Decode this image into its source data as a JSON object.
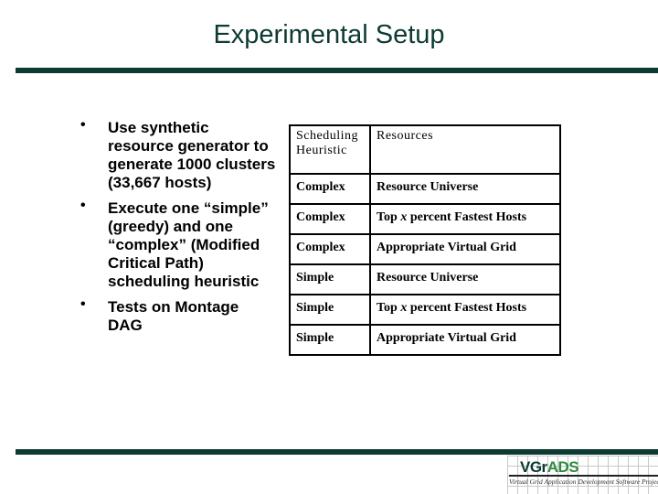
{
  "slide": {
    "title": "Experimental Setup",
    "bullets": [
      "Use synthetic resource generator to generate 1000 clusters (33,667 hosts)",
      "Execute one “simple” (greedy) and one “complex” (Modified Critical Path) scheduling heuristic",
      "Tests on Montage DAG"
    ],
    "bullet_glyph": "•",
    "table": {
      "headers": [
        "Scheduling Heuristic",
        "Resources"
      ],
      "rows": [
        [
          "Complex",
          "Resource Universe"
        ],
        [
          "Complex",
          "Top x percent Fastest Hosts"
        ],
        [
          "Complex",
          "Appropriate Virtual Grid"
        ],
        [
          "Simple",
          "Resource Universe"
        ],
        [
          "Simple",
          "Top x percent Fastest Hosts"
        ],
        [
          "Simple",
          "Appropriate Virtual Grid"
        ]
      ]
    },
    "logo": {
      "name_main": "VGr",
      "name_accent": "ADS",
      "subtitle": "Virtual Grid Application Development Software Project"
    },
    "colors": {
      "accent": "#0d3a33",
      "logo_accent": "#2e8b3c"
    }
  }
}
